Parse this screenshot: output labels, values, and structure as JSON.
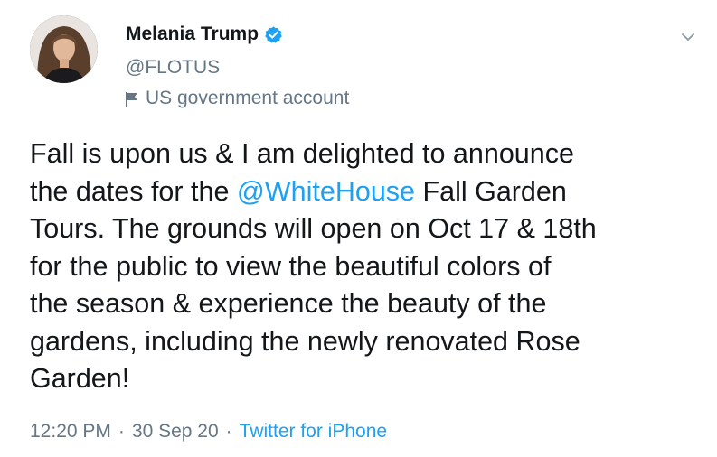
{
  "author": {
    "display_name": "Melania Trump",
    "handle": "@FLOTUS",
    "label": "US government account",
    "verified": true,
    "avatar_icon": "profile-photo"
  },
  "tweet": {
    "lines": [
      [
        "Fall is upon us & I am delighted to announce"
      ],
      [
        "the dates for the ",
        "@WhiteHouse",
        " Fall Garden"
      ],
      [
        "Tours. The grounds will open on Oct 17 & 18th"
      ],
      [
        "for the public to view the beautiful colors of"
      ],
      [
        "the season & experience the beauty of the"
      ],
      [
        "gardens, including the newly renovated Rose"
      ],
      [
        "Garden!"
      ]
    ],
    "mention": "@WhiteHouse"
  },
  "meta": {
    "time": "12:20 PM",
    "separator": "·",
    "date": "30 Sep 20",
    "source": "Twitter for iPhone"
  },
  "colors": {
    "link": "#1da1f2",
    "secondary_text": "#657786",
    "primary_text": "#14171a",
    "verified_badge": "#1da1f2"
  },
  "icons": {
    "verified": "verified-badge-icon",
    "label": "flag-icon",
    "menu": "chevron-down-icon"
  }
}
